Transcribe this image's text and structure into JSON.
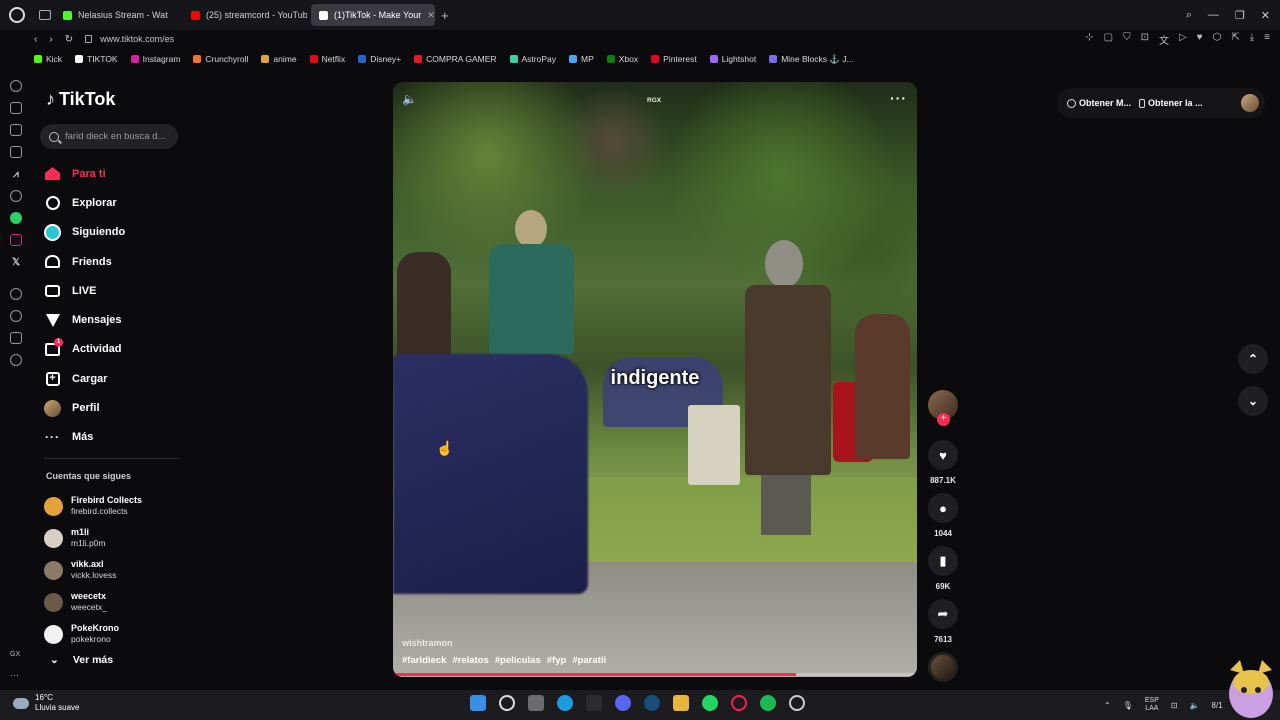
{
  "browser": {
    "tabs": [
      {
        "label": "Nelasius Stream - Wat",
        "color": "#53fc18",
        "active": false
      },
      {
        "label": "(25) streamcord - YouTub",
        "color": "#ff0000",
        "active": false
      },
      {
        "label": "(1)TikTok - Make Your",
        "color": "#ffffff",
        "active": true
      }
    ],
    "url": "www.tiktok.com/es",
    "bookmarks": [
      {
        "label": "Kick",
        "color": "#53fc18"
      },
      {
        "label": "TIKTOK",
        "color": "#ffffff"
      },
      {
        "label": "Instagram",
        "color": "#d6249f"
      },
      {
        "label": "Crunchyroll",
        "color": "#f47521"
      },
      {
        "label": "anime",
        "color": "#d9a441"
      },
      {
        "label": "Netflix",
        "color": "#e50914"
      },
      {
        "label": "Disney+",
        "color": "#2a63c9"
      },
      {
        "label": "COMPRA GAMER",
        "color": "#e31b23"
      },
      {
        "label": "AstroPay",
        "color": "#3ad29f"
      },
      {
        "label": "MP",
        "color": "#4aa3ff"
      },
      {
        "label": "Xbox",
        "color": "#107c10"
      },
      {
        "label": "Pinterest",
        "color": "#e60023"
      },
      {
        "label": "Lightshot",
        "color": "#a466ff"
      },
      {
        "label": "Mine Blocks ⚓ J...",
        "color": "#7a6cf0"
      }
    ],
    "gx_label": "GX",
    "gx_more": "···"
  },
  "tiktok": {
    "logo": "TikTok",
    "search_placeholder": "farid dieck en busca d...",
    "menu": [
      {
        "label": "Para ti",
        "icon": "home-icon"
      },
      {
        "label": "Explorar",
        "icon": "compass-icon"
      },
      {
        "label": "Siguiendo",
        "icon": "following-icon"
      },
      {
        "label": "Friends",
        "icon": "friends-icon"
      },
      {
        "label": "LIVE",
        "icon": "live-icon"
      },
      {
        "label": "Mensajes",
        "icon": "messages-icon"
      },
      {
        "label": "Actividad",
        "icon": "activity-icon",
        "badge": "1"
      },
      {
        "label": "Cargar",
        "icon": "upload-icon"
      },
      {
        "label": "Perfil",
        "icon": "profile-icon"
      },
      {
        "label": "Más",
        "icon": "more-icon"
      }
    ],
    "following_title": "Cuentas que sigues",
    "accounts": [
      {
        "name": "Firebird Collects",
        "handle": "firebird.collects",
        "color": "#e5a23a"
      },
      {
        "name": "m1li",
        "handle": "m1li.p0m",
        "color": "#d8d0c4"
      },
      {
        "name": "vikk.axl",
        "handle": "vickk.lovess",
        "color": "#8b7a66"
      },
      {
        "name": "weecetx",
        "handle": "weecetx_",
        "color": "#6b5a48"
      },
      {
        "name": "PokeKrono",
        "handle": "pokekrono",
        "color": "#f2f2f2"
      }
    ],
    "see_more": "Ver más",
    "top_right": {
      "item1": "Obtener M...",
      "item2": "Obtener la ..."
    }
  },
  "video": {
    "caption": "indigente",
    "watermark": "RGX",
    "author": "wishtramon",
    "tags": [
      "#faridieck",
      "#relatos",
      "#peliculas",
      "#fyp",
      "#paratii"
    ],
    "progress": 0.77
  },
  "actions": {
    "likes": "887.1K",
    "comments": "1044",
    "saves": "69K",
    "shares": "7613"
  },
  "taskbar": {
    "temp": "16°C",
    "weather": "Lluvia suave",
    "lang_top": "ESP",
    "lang_bottom": "LAA",
    "date": "8/1"
  }
}
